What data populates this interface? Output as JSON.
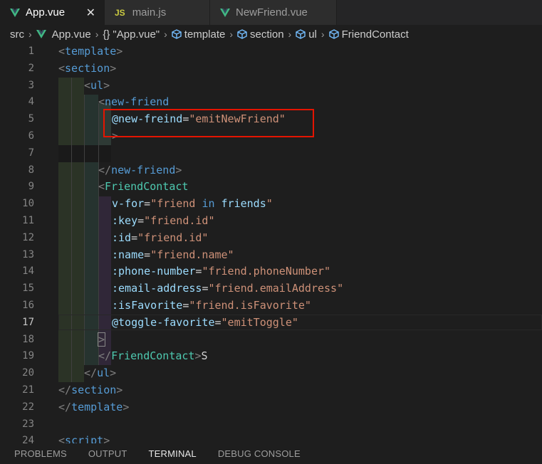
{
  "tabs": [
    {
      "label": "App.vue",
      "icon": "vue-icon",
      "active": true,
      "close": "✕"
    },
    {
      "label": "main.js",
      "icon": "js-icon",
      "icon_text": "JS",
      "active": false
    },
    {
      "label": "NewFriend.vue",
      "icon": "vue-icon",
      "active": false
    }
  ],
  "breadcrumb": {
    "items": [
      "src",
      "App.vue",
      "\"App.vue\"",
      "template",
      "section",
      "ul",
      "FriendContact"
    ],
    "object_glyph": "{}"
  },
  "editor": {
    "lines": [
      {
        "n": "1"
      },
      {
        "n": "2"
      },
      {
        "n": "3"
      },
      {
        "n": "4"
      },
      {
        "n": "5"
      },
      {
        "n": "6"
      },
      {
        "n": "7"
      },
      {
        "n": "8"
      },
      {
        "n": "9"
      },
      {
        "n": "10"
      },
      {
        "n": "11"
      },
      {
        "n": "12"
      },
      {
        "n": "13"
      },
      {
        "n": "14"
      },
      {
        "n": "15"
      },
      {
        "n": "16"
      },
      {
        "n": "17"
      },
      {
        "n": "18"
      },
      {
        "n": "19"
      },
      {
        "n": "20"
      },
      {
        "n": "21"
      },
      {
        "n": "22"
      },
      {
        "n": "23"
      },
      {
        "n": "24"
      }
    ],
    "current_line": "17",
    "code": {
      "l1": {
        "lt": "<",
        "tag": "template",
        "gt": ">"
      },
      "l2": {
        "lt": "<",
        "tag": "section",
        "gt": ">"
      },
      "l3": {
        "lt": "<",
        "tag": "ul",
        "gt": ">"
      },
      "l4": {
        "lt": "<",
        "tag": "new-friend"
      },
      "l5": {
        "attr": "@new-freind",
        "eq": "=",
        "val": "\"emitNewFriend\""
      },
      "l6": {
        "gt": ">"
      },
      "l8": {
        "lt": "</",
        "tag": "new-friend",
        "gt": ">"
      },
      "l9": {
        "lt": "<",
        "tag": "FriendContact"
      },
      "l10": {
        "attr": "v-for",
        "eq": "=",
        "q1": "\"friend ",
        "kw": "in",
        "rest": " friends",
        "q2": "\""
      },
      "l11": {
        "attr": ":key",
        "eq": "=",
        "val": "\"friend.id\""
      },
      "l12": {
        "attr": ":id",
        "eq": "=",
        "val": "\"friend.id\""
      },
      "l13": {
        "attr": ":name",
        "eq": "=",
        "val": "\"friend.name\""
      },
      "l14": {
        "attr": ":phone-number",
        "eq": "=",
        "val": "\"friend.phoneNumber\""
      },
      "l15": {
        "attr": ":email-address",
        "eq": "=",
        "val": "\"friend.emailAddress\""
      },
      "l16": {
        "attr": ":isFavorite",
        "eq": "=",
        "val": "\"friend.isFavorite\""
      },
      "l17": {
        "attr": "@toggle-favorite",
        "eq": "=",
        "val": "\"emitToggle\""
      },
      "l18": {
        "gt": ">"
      },
      "l19": {
        "lt": "</",
        "tag": "FriendContact",
        "gt": ">",
        "tail": "S"
      },
      "l20": {
        "lt": "</",
        "tag": "ul",
        "gt": ">"
      },
      "l21": {
        "lt": "</",
        "tag": "section",
        "gt": ">"
      },
      "l22": {
        "lt": "</",
        "tag": "template",
        "gt": ">"
      },
      "l24": {
        "lt": "<",
        "tag": "script",
        "gt": ">"
      }
    }
  },
  "panel": {
    "tabs": [
      {
        "label": "PROBLEMS",
        "active": false
      },
      {
        "label": "OUTPUT",
        "active": false
      },
      {
        "label": "TERMINAL",
        "active": true
      },
      {
        "label": "DEBUG CONSOLE",
        "active": false
      }
    ]
  },
  "colors": {
    "tag": "#569cd6",
    "component": "#4ec9b0",
    "attribute": "#9cdcfe",
    "string": "#ce9178",
    "highlight_box": "#e51400",
    "vue_green": "#41b883"
  }
}
